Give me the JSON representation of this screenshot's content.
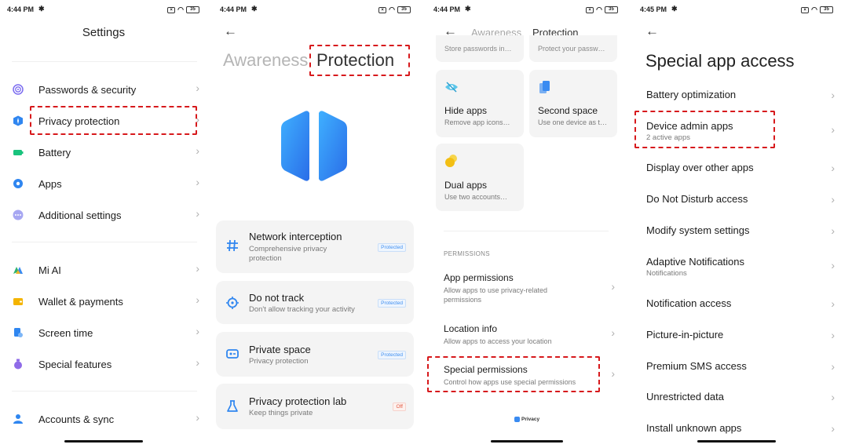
{
  "colors": {
    "accent": "#3a8bf1",
    "highlight": "#d7191c",
    "badge_off": "#e2573f"
  },
  "panel1": {
    "status": {
      "time": "4:44 PM",
      "battery": "35"
    },
    "title": "Settings",
    "items": [
      {
        "label": "Passwords & security",
        "icon": "fingerprint-icon"
      },
      {
        "label": "Privacy protection",
        "icon": "shield-icon"
      },
      {
        "label": "Battery",
        "icon": "battery-icon"
      },
      {
        "label": "Apps",
        "icon": "gear-icon"
      },
      {
        "label": "Additional settings",
        "icon": "dots-icon"
      },
      {
        "label": "Mi AI",
        "icon": "mi-ai-icon"
      },
      {
        "label": "Wallet & payments",
        "icon": "wallet-icon"
      },
      {
        "label": "Screen time",
        "icon": "hourglass-icon"
      },
      {
        "label": "Special features",
        "icon": "potion-icon"
      },
      {
        "label": "Accounts & sync",
        "icon": "account-icon"
      }
    ]
  },
  "panel2": {
    "status": {
      "time": "4:44 PM",
      "battery": "35"
    },
    "tabs": {
      "awareness": "Awareness",
      "protection": "Protection"
    },
    "cards": [
      {
        "title": "Network interception",
        "subtitle": "Comprehensive privacy protection",
        "badge": "Protected",
        "icon": "hash-icon"
      },
      {
        "title": "Do not track",
        "subtitle": "Don't allow tracking your activity",
        "badge": "Protected",
        "icon": "crosshair-icon"
      },
      {
        "title": "Private space",
        "subtitle": "Privacy protection",
        "badge": "Protected",
        "icon": "private-space-icon"
      },
      {
        "title": "Privacy protection lab",
        "subtitle": "Keep things private",
        "badge": "Off",
        "icon": "flask-icon"
      }
    ]
  },
  "panel3": {
    "status": {
      "time": "4:44 PM",
      "battery": "35"
    },
    "tabs": {
      "awareness": "Awareness",
      "protection": "Protection"
    },
    "clipped": {
      "left": "Store passwords in…",
      "right": "Protect your passw…"
    },
    "tiles": [
      {
        "title": "Hide apps",
        "subtitle": "Remove app icons…",
        "icon": "eye-hidden-icon"
      },
      {
        "title": "Second space",
        "subtitle": "Use one device as t…",
        "icon": "second-space-icon"
      },
      {
        "title": "Dual apps",
        "subtitle": "Use two accounts…",
        "icon": "dual-apps-icon"
      }
    ],
    "section_label": "PERMISSIONS",
    "items": [
      {
        "title": "App permissions",
        "subtitle": "Allow apps to use privacy-related permissions"
      },
      {
        "title": "Location info",
        "subtitle": "Allow apps to access your location"
      },
      {
        "title": "Special permissions",
        "subtitle": "Control how apps use special permissions"
      }
    ],
    "footer": "Privacy"
  },
  "panel4": {
    "status": {
      "time": "4:45 PM",
      "battery": "35"
    },
    "title": "Special app access",
    "items": [
      {
        "title": "Battery optimization",
        "subtitle": ""
      },
      {
        "title": "Device admin apps",
        "subtitle": "2 active apps"
      },
      {
        "title": "Display over other apps",
        "subtitle": ""
      },
      {
        "title": "Do Not Disturb access",
        "subtitle": ""
      },
      {
        "title": "Modify system settings",
        "subtitle": ""
      },
      {
        "title": "Adaptive Notifications",
        "subtitle": "Notifications"
      },
      {
        "title": "Notification access",
        "subtitle": ""
      },
      {
        "title": "Picture-in-picture",
        "subtitle": ""
      },
      {
        "title": "Premium SMS access",
        "subtitle": ""
      },
      {
        "title": "Unrestricted data",
        "subtitle": ""
      },
      {
        "title": "Install unknown apps",
        "subtitle": ""
      }
    ]
  }
}
